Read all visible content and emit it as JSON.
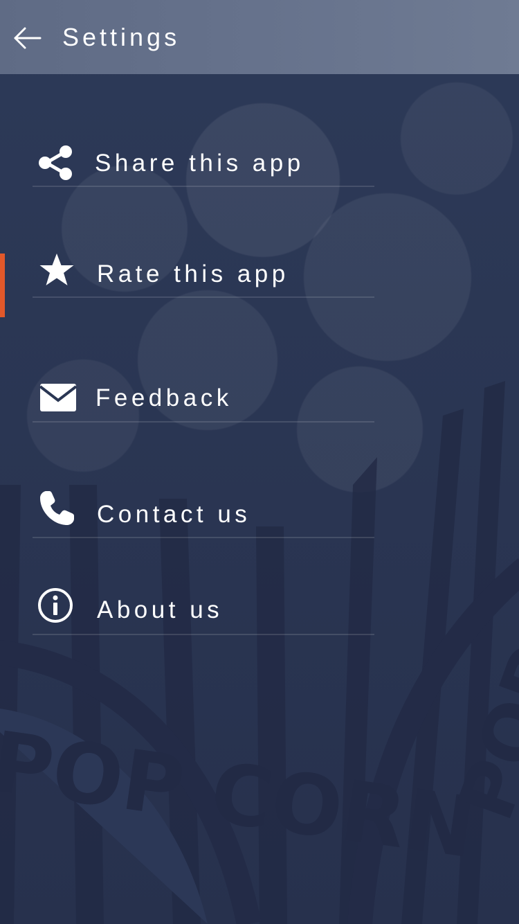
{
  "header": {
    "title": "Settings",
    "back_icon": "arrow-left-icon"
  },
  "menu": {
    "items": [
      {
        "label": "Share this app",
        "icon": "share-icon"
      },
      {
        "label": "Rate this app",
        "icon": "star-icon",
        "active": true
      },
      {
        "label": "Feedback",
        "icon": "envelope-icon"
      },
      {
        "label": "Contact us",
        "icon": "phone-icon"
      },
      {
        "label": "About us",
        "icon": "info-icon"
      }
    ]
  },
  "colors": {
    "background": "#2a3653",
    "header": "#66728c",
    "accent": "#e2582a",
    "text": "#ffffff"
  },
  "background_art": {
    "text_left": "POP CORN",
    "text_right": "POP CORN"
  }
}
